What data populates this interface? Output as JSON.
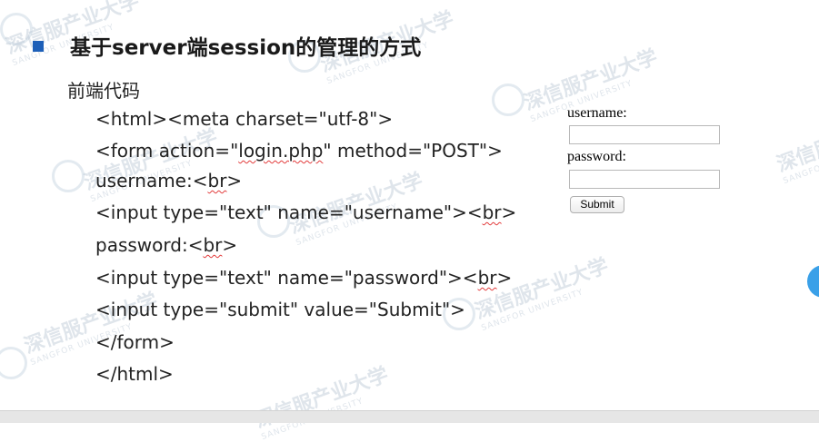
{
  "slide": {
    "title": "基于server端session的管理的方式",
    "subtitle": "前端代码",
    "code_lines": [
      "<html><meta charset=\"utf-8\">",
      "<form action=\"login.php\" method=\"POST\">",
      "username:<br>",
      "<input type=\"text\" name=\"username\"><br>",
      "password:<br>",
      "<input type=\"text\" name=\"password\"><br>",
      "<input type=\"submit\" value=\"Submit\">",
      "</form>",
      "</html>"
    ]
  },
  "demo_form": {
    "username_label": "username:",
    "password_label": "password:",
    "submit_label": "Submit"
  },
  "watermark": {
    "text": "深信服产业大学",
    "subtext": "SANGFOR UNIVERSITY"
  },
  "colors": {
    "bullet": "#1d5fb8",
    "spellcheck_underline": "#e23b3b",
    "side_button": "#3aa0e8"
  }
}
